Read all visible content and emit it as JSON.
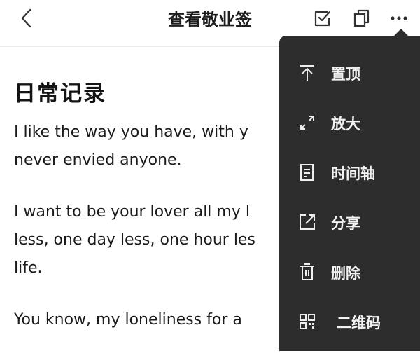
{
  "header": {
    "title": "查看敬业签",
    "back_icon": "chevron-left-icon",
    "actions": [
      "checkbox-edit-icon",
      "copy-icon",
      "more-icon"
    ]
  },
  "note": {
    "title": "日常记录",
    "paragraphs": [
      [
        "I like the way you have, with y",
        "never envied anyone."
      ],
      [
        "I want to be your lover all my l",
        "less, one day less, one hour les",
        "life."
      ],
      [
        "You know, my loneliness for a"
      ]
    ]
  },
  "menu": {
    "items": [
      {
        "label": "置顶",
        "icon": "pin-top-icon"
      },
      {
        "label": "放大",
        "icon": "expand-icon"
      },
      {
        "label": "时间轴",
        "icon": "timeline-icon"
      },
      {
        "label": "分享",
        "icon": "share-icon"
      },
      {
        "label": "删除",
        "icon": "trash-icon"
      },
      {
        "label": "二维码",
        "icon": "qr-code-icon"
      }
    ]
  },
  "colors": {
    "menu_bg": "#2d2d2d",
    "menu_text": "#f2f2f2",
    "text": "#1a1a1a"
  }
}
